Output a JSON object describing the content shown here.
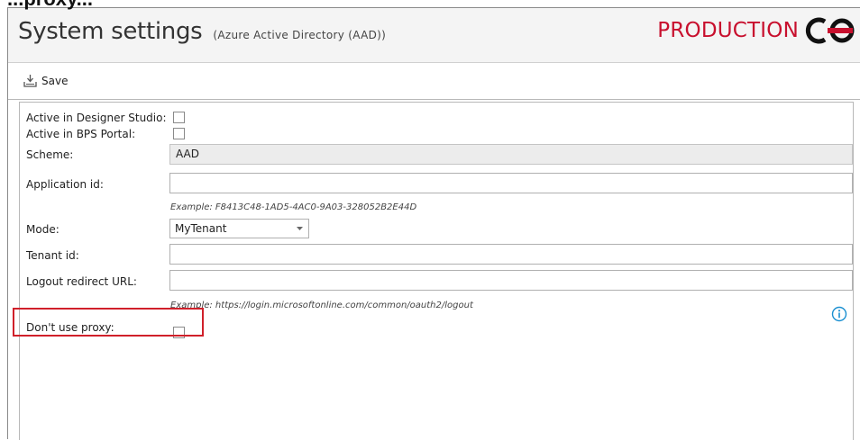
{
  "page": {
    "heading": "...proxy..."
  },
  "window": {
    "title": "System settings",
    "subtitle": "(Azure Active Directory (AAD))",
    "brand": "PRODUCTION",
    "brand_color": "#c8102e"
  },
  "toolbar": {
    "save_label": "Save",
    "save_icon": "save-icon"
  },
  "form": {
    "active_designer": {
      "label": "Active in Designer Studio:",
      "checked": false
    },
    "active_bps": {
      "label": "Active in BPS Portal:",
      "checked": false
    },
    "scheme": {
      "label": "Scheme:",
      "value": "AAD"
    },
    "application_id": {
      "label": "Application id:",
      "value": "",
      "hint": "Example: F8413C48-1AD5-4AC0-9A03-328052B2E44D"
    },
    "mode": {
      "label": "Mode:",
      "value": "MyTenant"
    },
    "tenant_id": {
      "label": "Tenant id:",
      "value": ""
    },
    "logout_url": {
      "label": "Logout redirect URL:",
      "value": "",
      "hint": "Example: https://login.microsoftonline.com/common/oauth2/logout"
    },
    "dont_use_proxy": {
      "label": "Don't use proxy:",
      "checked": false,
      "highlight_color": "#d0202a"
    }
  },
  "info_icon": {
    "name": "info-icon",
    "color": "#1a8fd1"
  }
}
